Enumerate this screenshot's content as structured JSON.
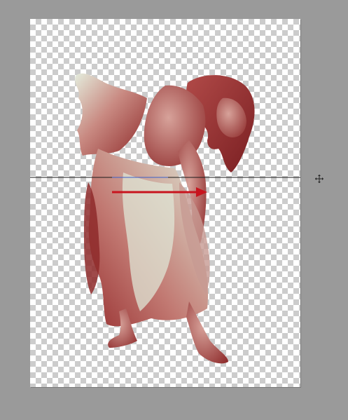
{
  "document": {
    "layer_content": "figure-in-dress",
    "tint_dark": "#8e2a2a",
    "tint_mid": "#b45a55",
    "tint_light": "#d9e3d0"
  },
  "guide": {
    "color": "#1a1a1a",
    "accent_color": "#3a5fc9"
  },
  "annotation": {
    "arrow_color": "#c8141e",
    "arrow_direction": "right"
  },
  "cursor": {
    "icon": "crosshair-move-cursor-icon"
  },
  "workspace": {
    "background": "#9a9a9a"
  }
}
